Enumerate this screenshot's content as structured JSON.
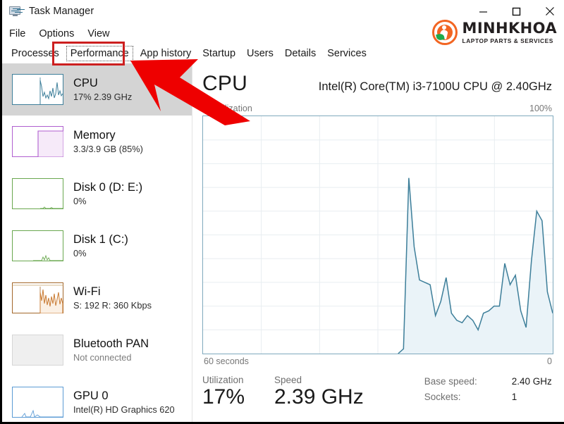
{
  "window": {
    "title": "Task Manager",
    "icon": "task-manager-icon",
    "controls": {
      "minimize": "–",
      "maximize": "□",
      "close": "✕"
    }
  },
  "branding": {
    "name": "MINHKHOA",
    "tagline": "LAPTOP PARTS & SERVICES",
    "accent": "#f26522",
    "leaf_color": "#1faa4b"
  },
  "menu": {
    "items": [
      "File",
      "Options",
      "View"
    ]
  },
  "tabs": {
    "items": [
      {
        "label": "Processes",
        "selected": false
      },
      {
        "label": "Performance",
        "selected": true
      },
      {
        "label": "App history",
        "selected": false
      },
      {
        "label": "Startup",
        "selected": false
      },
      {
        "label": "Users",
        "selected": false
      },
      {
        "label": "Details",
        "selected": false
      },
      {
        "label": "Services",
        "selected": false
      }
    ],
    "highlight_color": "#cc1f1f"
  },
  "sidebar": {
    "items": [
      {
        "name": "CPU",
        "detail": "17%  2.39 GHz",
        "active": true,
        "accent": "#3e7f9a",
        "thumb": "cpu-sparkline"
      },
      {
        "name": "Memory",
        "detail": "3.3/3.9 GB (85%)",
        "active": false,
        "accent": "#a855c4",
        "thumb": "memory-fill"
      },
      {
        "name": "Disk 0 (D: E:)",
        "detail": "0%",
        "active": false,
        "accent": "#6aa84f",
        "thumb": "disk-flat"
      },
      {
        "name": "Disk 1 (C:)",
        "detail": "0%",
        "active": false,
        "accent": "#6aa84f",
        "thumb": "disk-flat-2"
      },
      {
        "name": "Wi-Fi",
        "detail": "S: 192  R: 360 Kbps",
        "active": false,
        "accent": "#a3672a",
        "thumb": "wifi-sparkline"
      },
      {
        "name": "Bluetooth PAN",
        "detail": "Not connected",
        "active": false,
        "muted": true,
        "accent": "#c9c9c9",
        "thumb": "bluetooth-empty"
      },
      {
        "name": "GPU 0",
        "detail": "Intel(R) HD Graphics 620",
        "active": false,
        "accent": "#5b9bd5",
        "thumb": "gpu-sparkline"
      }
    ]
  },
  "main": {
    "title": "CPU",
    "model": "Intel(R) Core(TM) i3-7100U CPU @ 2.40GHz",
    "graph": {
      "y_label": "% Utilization",
      "y_max_label": "100%",
      "x_left_label": "60 seconds",
      "x_right_label": "0",
      "line_color": "#3e7f9a",
      "fill_color": "#eaf3f8",
      "border_color": "#7fa9bd"
    },
    "stats": [
      {
        "label": "Utilization",
        "value": "17%"
      },
      {
        "label": "Speed",
        "value": "2.39 GHz"
      }
    ],
    "details": [
      {
        "key": "Base speed:",
        "value": "2.40 GHz"
      },
      {
        "key": "Sockets:",
        "value": "1"
      }
    ]
  },
  "annotation": {
    "arrow_color": "#ee0000",
    "arrow_name": "red-pointer-arrow",
    "points_to": "Performance"
  },
  "chart_data": {
    "type": "area",
    "title": "% Utilization",
    "xlabel": "60 seconds",
    "ylabel": "% Utilization",
    "ylim": [
      0,
      100
    ],
    "xlim": [
      0,
      60
    ],
    "grid": true,
    "grid_rows": 10,
    "grid_cols": 6,
    "x": [
      33.5,
      34.0,
      34.5,
      35.2,
      36.0,
      37.0,
      38.0,
      39.0,
      40.0,
      41.0,
      42.0,
      43.0,
      44.0,
      45.0,
      46.0,
      47.0,
      48.0,
      49.0,
      50.0,
      51.0,
      52.0,
      53.0,
      54.0,
      55.0,
      56.0,
      57.0,
      58.0,
      59.0,
      60.0
    ],
    "values": [
      0,
      2,
      74,
      45,
      31,
      30,
      29,
      16,
      22,
      32,
      17,
      14,
      13,
      16,
      14,
      10,
      17,
      18,
      20,
      20,
      38,
      29,
      33,
      18,
      11,
      39,
      60,
      56,
      26,
      17
    ],
    "series": [
      {
        "name": "CPU utilization",
        "values": [
          0,
          2,
          74,
          45,
          31,
          30,
          29,
          16,
          22,
          32,
          17,
          14,
          13,
          16,
          14,
          10,
          17,
          18,
          20,
          20,
          38,
          29,
          33,
          18,
          11,
          39,
          60,
          56,
          26,
          17
        ],
        "color": "#3e7f9a"
      }
    ],
    "annotations": [
      "100%",
      "0",
      "60 seconds"
    ]
  }
}
